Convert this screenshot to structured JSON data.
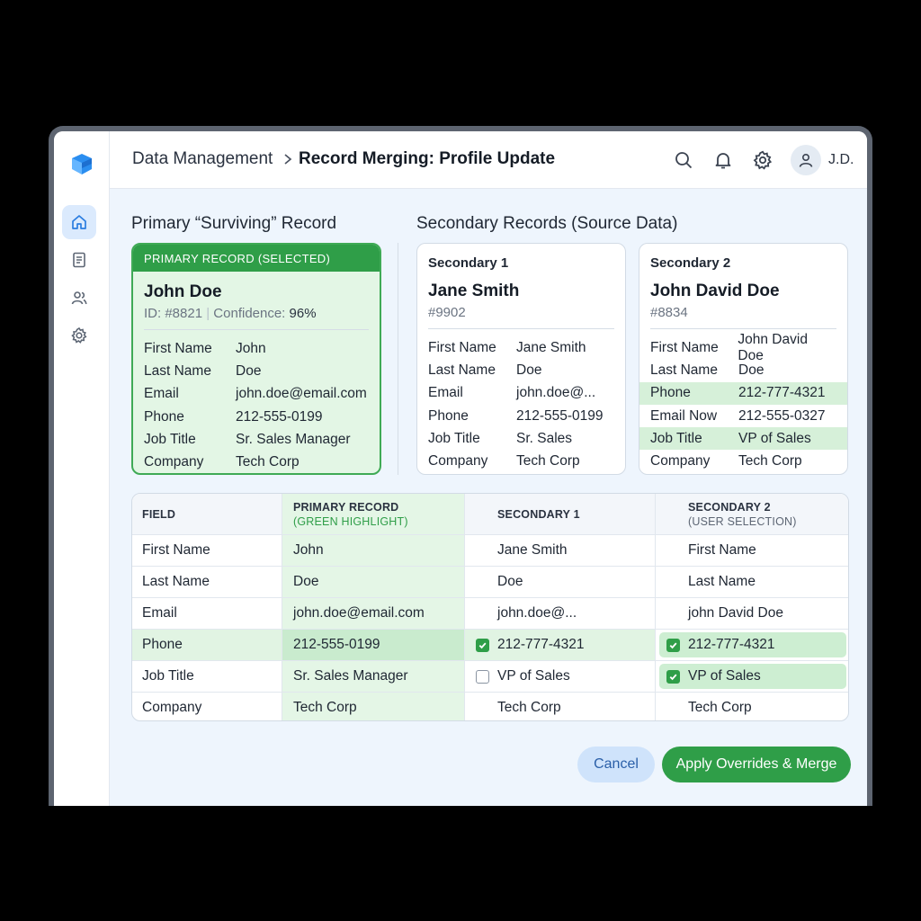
{
  "app": {
    "logo": "app-logo",
    "user_initials": "J.D."
  },
  "breadcrumb": {
    "parent": "Data Management",
    "current": "Record Merging: Profile Update"
  },
  "toolbar_icons": [
    "search-icon",
    "bell-icon",
    "gear-icon",
    "user-icon"
  ],
  "sidebar": {
    "items": [
      {
        "icon": "home-icon",
        "active": true
      },
      {
        "icon": "document-icon",
        "active": false
      },
      {
        "icon": "users-icon",
        "active": false
      },
      {
        "icon": "settings-icon",
        "active": false
      }
    ]
  },
  "sections": {
    "primary_title": "Primary “Surviving” Record",
    "secondary_title": "Secondary Records (Source Data)"
  },
  "primary_card": {
    "header": "PRIMARY RECORD (SELECTED)",
    "name": "John Doe",
    "id": "ID: #8821",
    "confidence_label": "Confidence:",
    "confidence_value": "96%",
    "fields": [
      {
        "label": "First Name",
        "value": "John"
      },
      {
        "label": "Last Name",
        "value": "Doe"
      },
      {
        "label": "Email",
        "value": "john.doe@email.com"
      },
      {
        "label": "Phone",
        "value": "212-555-0199"
      },
      {
        "label": "Job Title",
        "value": "Sr. Sales Manager"
      },
      {
        "label": "Company",
        "value": "Tech Corp"
      }
    ]
  },
  "secondary_cards": [
    {
      "label": "Secondary 1",
      "name": "Jane Smith",
      "id": "#9902",
      "fields": [
        {
          "label": "First Name",
          "value": "Jane Smith"
        },
        {
          "label": "Last Name",
          "value": "Doe"
        },
        {
          "label": "Email",
          "value": "john.doe@..."
        },
        {
          "label": "Phone",
          "value": "212-555-0199"
        },
        {
          "label": "Job Title",
          "value": "Sr. Sales"
        },
        {
          "label": "Company",
          "value": "Tech Corp"
        }
      ]
    },
    {
      "label": "Secondary 2",
      "name": "John David Doe",
      "id": "#8834",
      "fields": [
        {
          "label": "First Name",
          "value": "John David Doe"
        },
        {
          "label": "Last Name",
          "value": "Doe"
        },
        {
          "label": "Phone",
          "value": "212-777-4321"
        },
        {
          "label": "Email Now",
          "value": "212-555-0327"
        },
        {
          "label": "Job Title",
          "value": "VP of Sales"
        },
        {
          "label": "Company",
          "value": "Tech Corp"
        }
      ]
    }
  ],
  "merge_table": {
    "headers": {
      "field": "FIELD",
      "primary": "PRIMARY RECORD",
      "primary_sub": "(GREEN HIGHLIGHT)",
      "s1": "SECONDARY 1",
      "s2": "SECONDARY 2",
      "s2_sub": "(USER SELECTION)"
    },
    "rows": [
      {
        "field": "First Name",
        "primary": "John",
        "s1": "Jane Smith",
        "s2": "First Name"
      },
      {
        "field": "Last Name",
        "primary": "Doe",
        "s1": "Doe",
        "s2": "Last Name"
      },
      {
        "field": "Email",
        "primary": "john.doe@email.com",
        "s1": "john.doe@...",
        "s2": "john David Doe"
      },
      {
        "field": "Phone",
        "primary": "212-555-0199",
        "s1": "212-777-4321",
        "s2": "212-777-4321",
        "s1_checked": true,
        "s2_checked": true
      },
      {
        "field": "Job Title",
        "primary": "Sr. Sales Manager",
        "s1": "VP of Sales",
        "s2": "VP of Sales",
        "s1_checked": false,
        "s2_checked": true
      },
      {
        "field": "Company",
        "primary": "Tech Corp",
        "s1": "Tech Corp",
        "s2": "Tech Corp"
      }
    ]
  },
  "actions": {
    "cancel": "Cancel",
    "apply": "Apply Overrides & Merge"
  },
  "colors": {
    "accent_green": "#2f9e48",
    "accent_blue": "#2a5fa8",
    "background": "#eef5fd"
  }
}
